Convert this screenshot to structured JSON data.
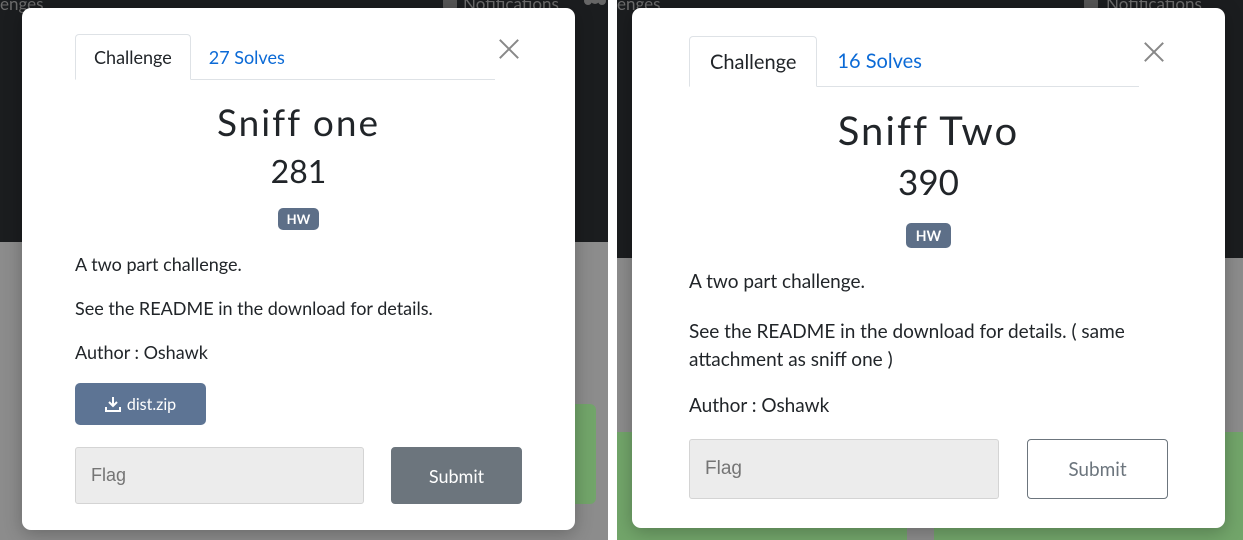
{
  "background": {
    "left_topbar_text": "enges",
    "left_notifications": "Notifications",
    "right_topbar_text": "enges",
    "right_notifications": "Notifications"
  },
  "left_modal": {
    "tabs": [
      {
        "label": "Challenge",
        "active": true
      },
      {
        "label": "27 Solves",
        "active": false
      }
    ],
    "title": "Sniff one",
    "points": "281",
    "tag": "HW",
    "description": [
      "A two part challenge.",
      "See the README in the download for details.",
      "Author : Oshawk"
    ],
    "download_label": "dist.zip",
    "flag_placeholder": "Flag",
    "submit_label": "Submit"
  },
  "right_modal": {
    "tabs": [
      {
        "label": "Challenge",
        "active": true
      },
      {
        "label": "16 Solves",
        "active": false
      }
    ],
    "title": "Sniff Two",
    "points": "390",
    "tag": "HW",
    "description": [
      "A two part challenge.",
      "See the README in the download for details. ( same attachment as sniff one )",
      "Author : Oshawk"
    ],
    "flag_placeholder": "Flag",
    "submit_label": "Submit"
  },
  "colors": {
    "link": "#0b6ad6",
    "tag_bg": "#5d6f88",
    "download_bg": "#5d7494",
    "submit_bg": "#6c757d",
    "card_green": "#72a56a",
    "navbar_bg": "#1b1d1f"
  }
}
